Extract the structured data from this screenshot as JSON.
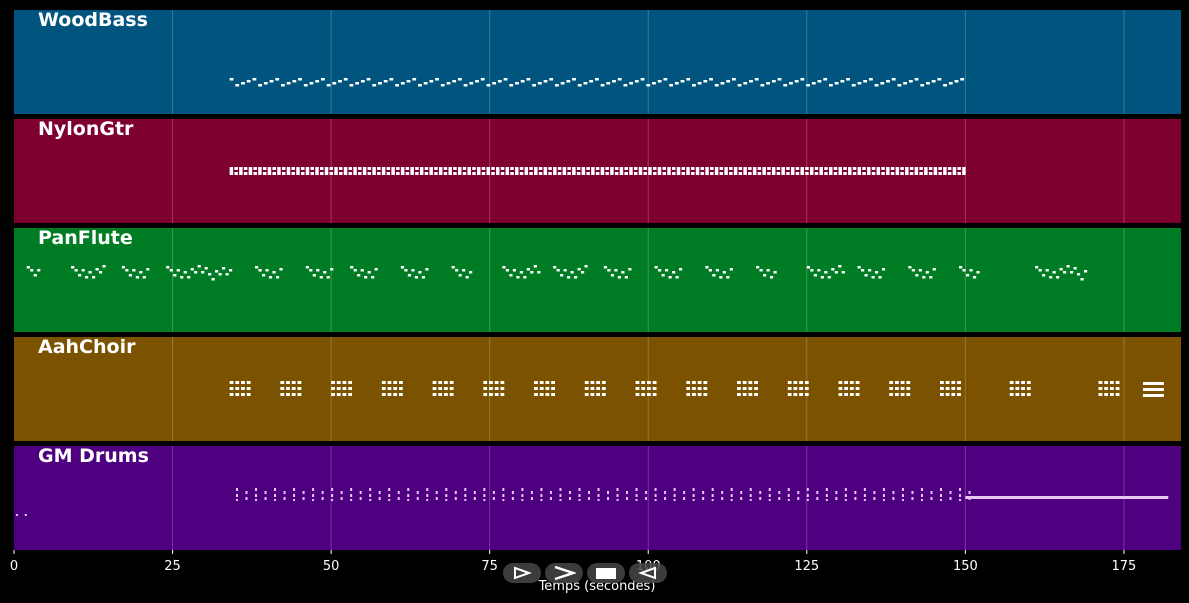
{
  "chart_data": {
    "type": "piano-roll",
    "xlabel": "Temps (secondes)",
    "xlim": [
      0,
      184
    ],
    "xticks": [
      0,
      25,
      50,
      75,
      100,
      125,
      150,
      175
    ],
    "tracks": [
      {
        "name": "WoodBass",
        "color": "#00547e",
        "active_range": [
          34,
          150
        ],
        "pattern": "bassline"
      },
      {
        "name": "NylonGtr",
        "color": "#7d0030",
        "active_range": [
          34,
          150
        ],
        "pattern": "chords"
      },
      {
        "name": "PanFlute",
        "color": "#007d24",
        "active_range": [
          2,
          169
        ],
        "pattern": "melody"
      },
      {
        "name": "AahChoir",
        "color": "#7a5200",
        "active_range": [
          34,
          182
        ],
        "pattern": "stabs"
      },
      {
        "name": "GM Drums",
        "color": "#4e0080",
        "active_range": [
          0,
          182
        ],
        "pattern": "drums"
      }
    ]
  },
  "controls": [
    {
      "name": "play-icon"
    },
    {
      "name": "forward-icon"
    },
    {
      "name": "stop-icon"
    },
    {
      "name": "rewind-icon"
    }
  ]
}
